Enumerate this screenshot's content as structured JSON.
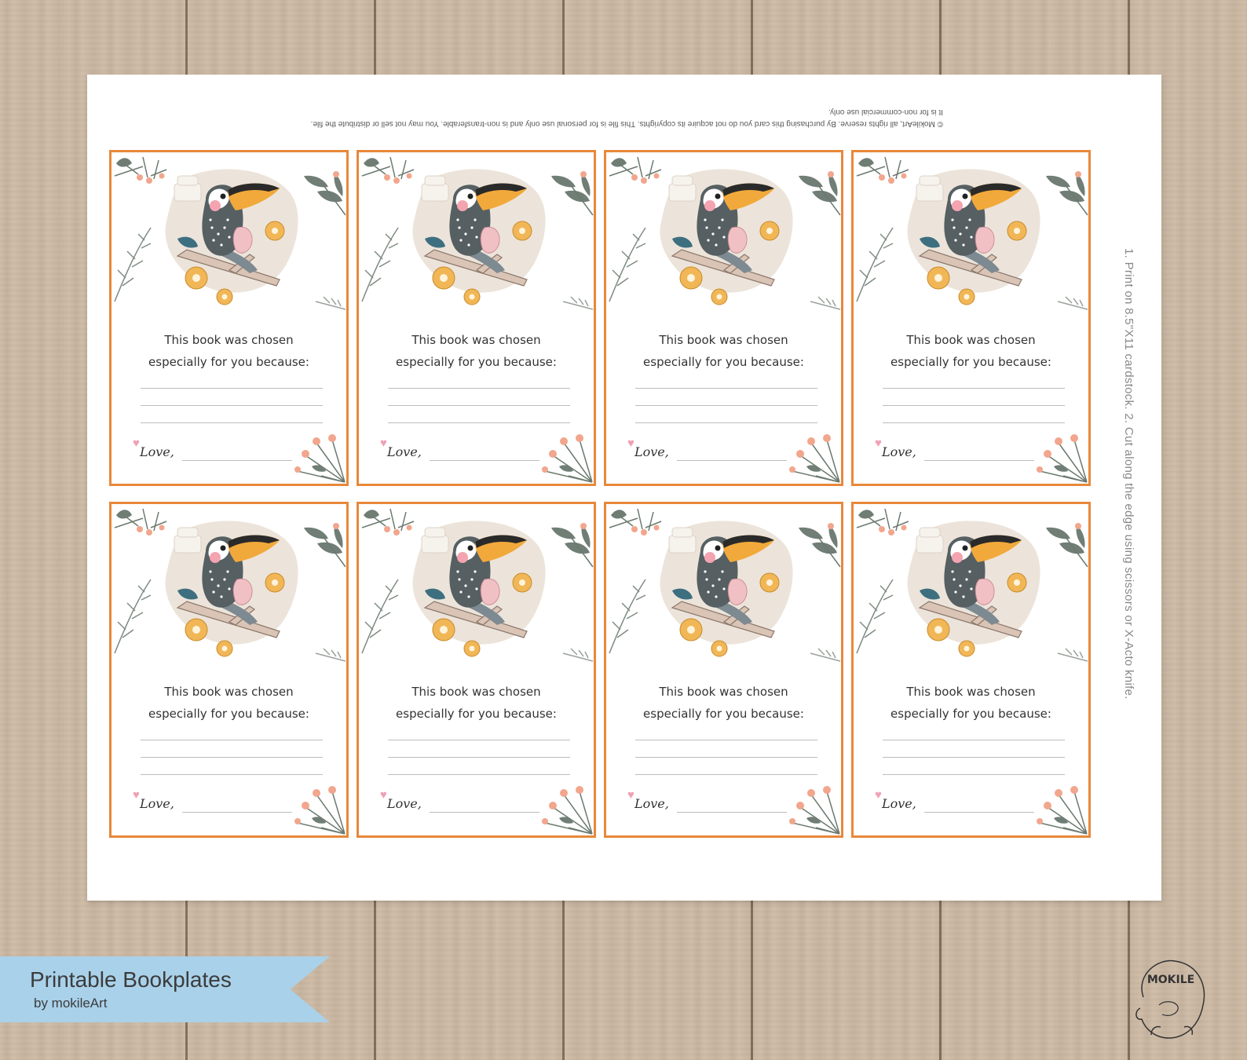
{
  "sheet": {
    "copyright_lines": [
      "© MokileArt, all rights reserve. By purchasing this card you do not acquire its copyrights. This file is for personal use only and is non-transferable. You may not sell or distribute the file.",
      "It is for non-commercial use only."
    ],
    "instructions": "1. Print on 8.5\"X11 cardstock.   2. Cut along the edge using scissors or X-Acto knife."
  },
  "card": {
    "line1": "This book was chosen",
    "line2": "especially for you because:",
    "love_label": "Love,"
  },
  "cards": [
    {
      "row": 1,
      "col": 1
    },
    {
      "row": 1,
      "col": 2
    },
    {
      "row": 1,
      "col": 3
    },
    {
      "row": 1,
      "col": 4
    },
    {
      "row": 2,
      "col": 1
    },
    {
      "row": 2,
      "col": 2
    },
    {
      "row": 2,
      "col": 3
    },
    {
      "row": 2,
      "col": 4
    }
  ],
  "banner": {
    "title": "Printable Bookplates",
    "byline": "by mokileArt"
  },
  "logo": {
    "text": "MOKILE"
  },
  "colors": {
    "card_border": "#e8883a",
    "banner": "#a9d1ea",
    "toucan_body": "#565f62",
    "beak": "#f2a93b",
    "blob": "#ece4da"
  }
}
